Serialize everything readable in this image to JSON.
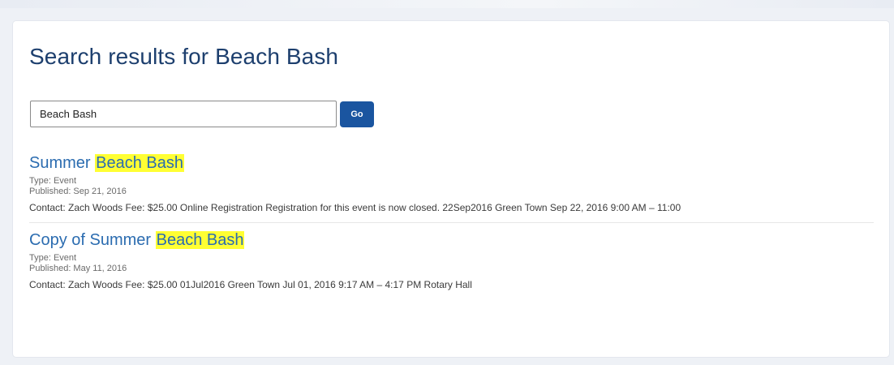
{
  "page": {
    "title": "Search results for Beach Bash"
  },
  "search": {
    "query": "Beach Bash",
    "button_label": "Go"
  },
  "results": [
    {
      "title_prefix": "Summer ",
      "title_highlight": "Beach Bash",
      "title_suffix": "",
      "type": "Type: Event",
      "published": "Published: Sep 21, 2016",
      "snippet": "Contact: Zach Woods Fee: $25.00 Online Registration Registration for this event is now closed. 22Sep2016 Green Town Sep 22, 2016 9:00 AM – 11:00"
    },
    {
      "title_prefix": "Copy of Summer ",
      "title_highlight": "Beach Bash",
      "title_suffix": "",
      "type": "Type: Event",
      "published": "Published: May 11, 2016",
      "snippet": "Contact: Zach Woods Fee: $25.00 01Jul2016 Green Town Jul 01, 2016 9:17 AM – 4:17 PM Rotary Hall"
    }
  ],
  "colors": {
    "title": "#1d3f6e",
    "link": "#2b6cb0",
    "highlight": "#ffff33",
    "button": "#1a55a0"
  }
}
